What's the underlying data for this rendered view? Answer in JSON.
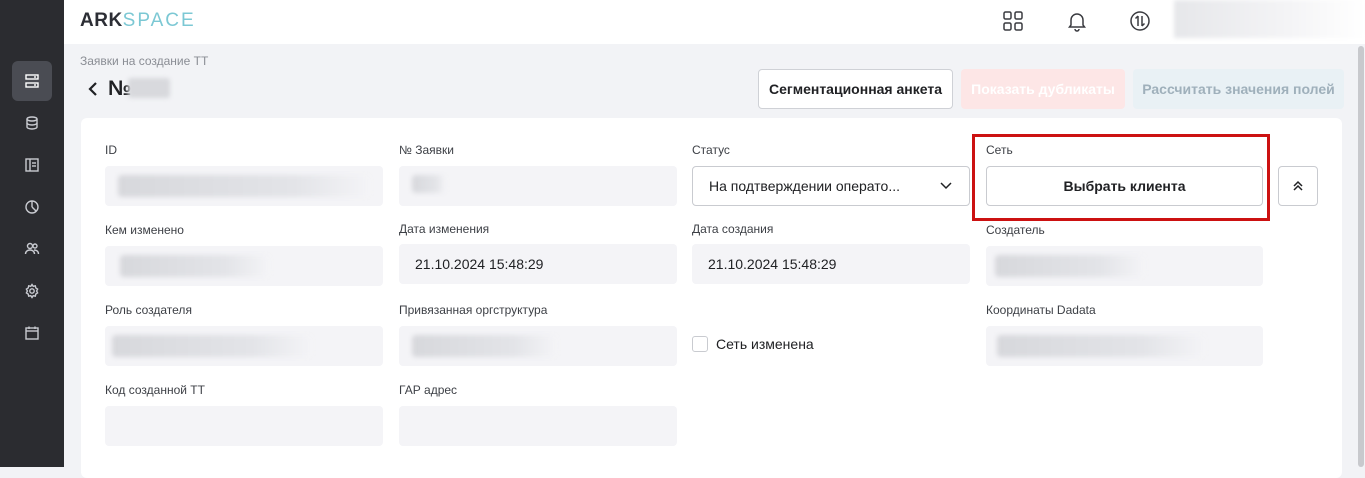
{
  "app": {
    "logo_part1": "ARK",
    "logo_part2": "SPACE"
  },
  "sidebar": {
    "items": [
      "list-icon",
      "database-icon",
      "layout-icon",
      "pie-chart-icon",
      "users-icon",
      "gear-icon",
      "calendar-icon"
    ],
    "active_index": 0
  },
  "topbar": {
    "icons": [
      "grid-icon",
      "bell-icon",
      "sync-icon"
    ]
  },
  "header": {
    "breadcrumb": "Заявки на создание ТТ",
    "title": "№",
    "buttons": {
      "segmentation": "Сегментационная анкета",
      "duplicates": "Показать дубликаты",
      "calculate": "Рассчитать значения полей"
    }
  },
  "form": {
    "id_label": "ID",
    "request_no_label": "№ Заявки",
    "status_label": "Статус",
    "status_value": "На подтверждении операто...",
    "network_label": "Сеть",
    "network_button": "Выбрать клиента",
    "changed_by_label": "Кем изменено",
    "changed_date_label": "Дата изменения",
    "changed_date_value": "21.10.2024 15:48:29",
    "created_date_label": "Дата создания",
    "created_date_value": "21.10.2024 15:48:29",
    "creator_label": "Создатель",
    "creator_role_label": "Роль создателя",
    "org_structure_label": "Привязанная оргструктура",
    "network_changed_label": "Сеть изменена",
    "network_changed_checked": false,
    "dadata_label": "Координаты Dadata",
    "created_tt_code_label": "Код созданной ТТ",
    "gar_address_label": "ГАР адрес"
  },
  "colors": {
    "highlight": "#cc1111",
    "sidebar_bg": "#2b2c30",
    "accent": "#7cc8d4"
  }
}
